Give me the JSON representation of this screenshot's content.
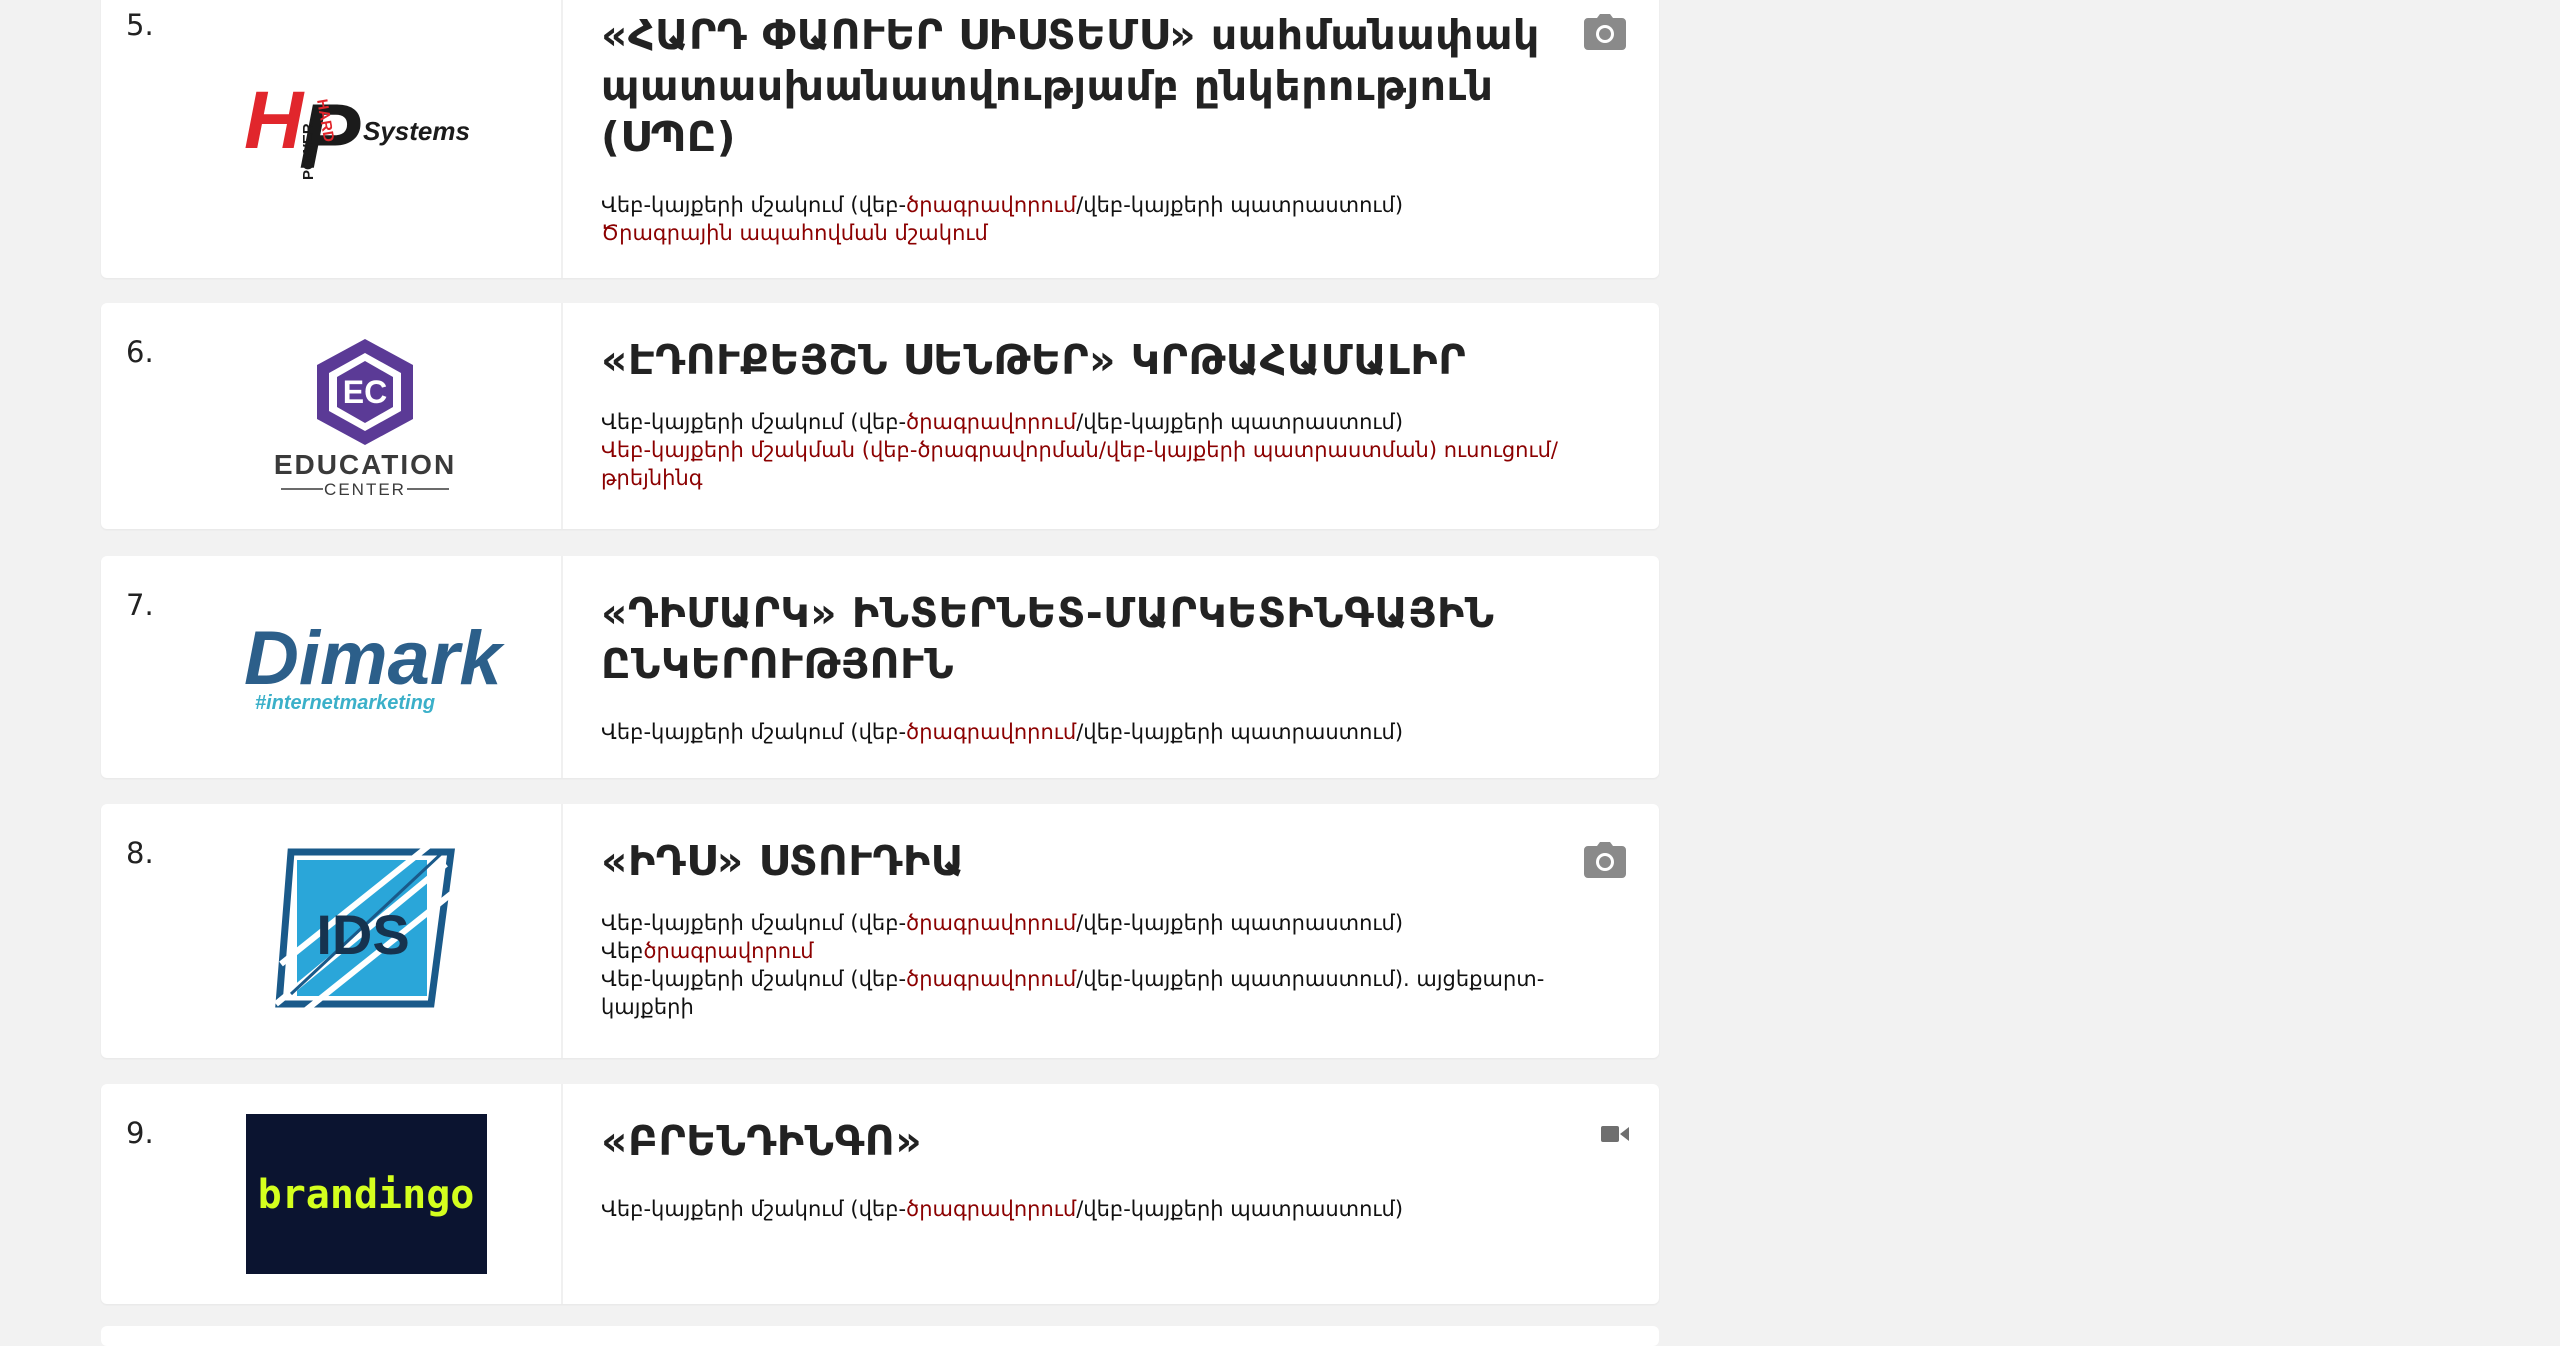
{
  "items": [
    {
      "number": "5.",
      "title": "«ՀԱՐԴ ՓԱՈՒԵՐ ՍԻՍՏԵՄՍ» սահմանափակ պատասխանատվությամբ ընկերություն (ՍՊԸ)",
      "logo_text": {
        "hard": "HARD",
        "power": "POWER",
        "systems": "Systems"
      },
      "line1": {
        "a": "Վեբ-կայքերի մշակում (վեբ-",
        "b": "ծրագրավորում",
        "c": "/վեբ-կայքերի պատրաստում)"
      },
      "line2": "Ծրագրային ապահովման մշակում",
      "icon": "camera-icon"
    },
    {
      "number": "6.",
      "title": "«ԷԴՈՒՔԵՅՇՆ ՍԵՆԹԵՐ» ԿՐԹԱՀԱՄԱԼԻՐ",
      "logo_text": {
        "ec": "EC",
        "education": "EDUCATION",
        "center": "CENTER"
      },
      "line1": {
        "a": "Վեբ-կայքերի մշակում (վեբ-",
        "b": "ծրագրավորում",
        "c": "/վեբ-կայքերի պատրաստում)"
      },
      "line2": "Վեբ-կայքերի մշակման (վեբ-ծրագրավորման/վեբ-կայքերի պատրաստման) ուսուցում/թրեյնինգ"
    },
    {
      "number": "7.",
      "title": "«ԴԻՄԱՐԿ» ԻՆՏԵՐՆԵՏ-ՄԱՐԿԵՏԻՆԳԱՅԻՆ ԸՆԿԵՐՈՒԹՅՈՒՆ",
      "logo_text": {
        "name": "Dimark",
        "tag": "#internetmarketing"
      },
      "line1": {
        "a": "Վեբ-կայքերի մշակում (վեբ-",
        "b": "ծրագրավորում",
        "c": "/վեբ-կայքերի պատրաստում)"
      }
    },
    {
      "number": "8.",
      "title": "«ԻԴՍ» ՍՏՈՒԴԻԱ",
      "logo_text": {
        "name": "IDS"
      },
      "line1": {
        "a": "Վեբ-կայքերի մշակում (վեբ-",
        "b": "ծրագրավորում",
        "c": "/վեբ-կայքերի պատրաստում)"
      },
      "line2": {
        "a": "Վեբ",
        "b": "ծրագրավորում"
      },
      "line3": {
        "a": "Վեբ-կայքերի մշակում (վեբ-",
        "b": "ծրագրավորում",
        "c": "/վեբ-կայքերի պատրաստում). այցեքարտ-կայքերի"
      },
      "icon": "camera-icon"
    },
    {
      "number": "9.",
      "title": "«ԲՐԵՆԴԻՆԳՈ»",
      "logo_text": {
        "name": "brandingo"
      },
      "line1": {
        "a": "Վեբ-կայքերի մշակում (վեբ-",
        "b": "ծրագրավորում",
        "c": "/վեբ-կայքերի պատրաստում)"
      },
      "icon": "video-camera-icon"
    }
  ],
  "colors": {
    "accent_red": "#8b0000",
    "background": "#f2f2f2",
    "card": "#ffffff",
    "icon_grey": "#8a8a8a"
  }
}
